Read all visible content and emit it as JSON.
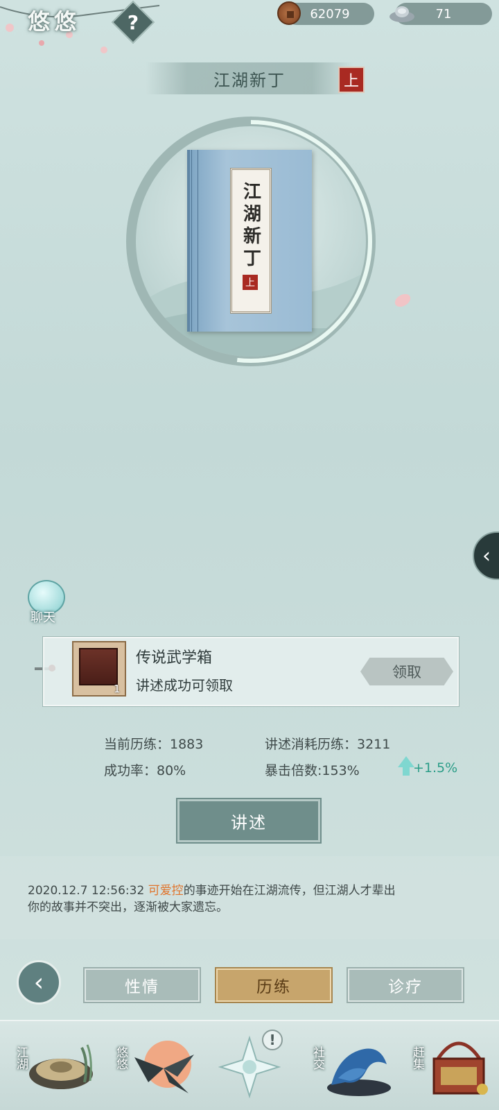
{
  "header": {
    "player_name": "悠悠",
    "help_glyph": "?",
    "copper": "62079",
    "silver": "71"
  },
  "book": {
    "ribbon_title": "江湖新丁",
    "volume": "上",
    "cover_title": "江湖新丁",
    "cover_volume": "上"
  },
  "chat": {
    "label": "聊天"
  },
  "reward": {
    "name": "传说武学箱",
    "desc": "讲述成功可领取",
    "count": "1",
    "claim_label": "领取"
  },
  "stats": {
    "current_exp_label": "当前历练：1883",
    "cost_exp_label": "讲述消耗历练：3211",
    "success_rate_label": "成功率：80%",
    "crit_label": "暴击倍数:153%",
    "crit_bonus": "+1.5%"
  },
  "actions": {
    "narrate_label": "讲述"
  },
  "log": {
    "timestamp": "2020.12.7 12:56:32",
    "name": "可爱控",
    "message_part1": "的事迹开始在江湖流传，但江湖人才辈出",
    "message_part2": "你的故事并不突出，逐渐被大家遗忘。"
  },
  "tabs": [
    {
      "label": "性情",
      "active": false
    },
    {
      "label": "历练",
      "active": true
    },
    {
      "label": "诊疗",
      "active": false
    }
  ],
  "bottom_nav": [
    {
      "label": "江湖",
      "icon": "hat-icon"
    },
    {
      "label": "悠悠",
      "icon": "bird-icon"
    },
    {
      "label": "",
      "icon": "compass-star-icon"
    },
    {
      "label": "社交",
      "icon": "wave-icon"
    },
    {
      "label": "赶集",
      "icon": "basket-icon"
    }
  ],
  "alert_glyph": "!",
  "colors": {
    "accent": "#6f8e8b",
    "active_tab": "#c7a56c",
    "highlight_name": "#e0742c",
    "bonus_green": "#2b9d88",
    "seal_red": "#a92a22"
  }
}
